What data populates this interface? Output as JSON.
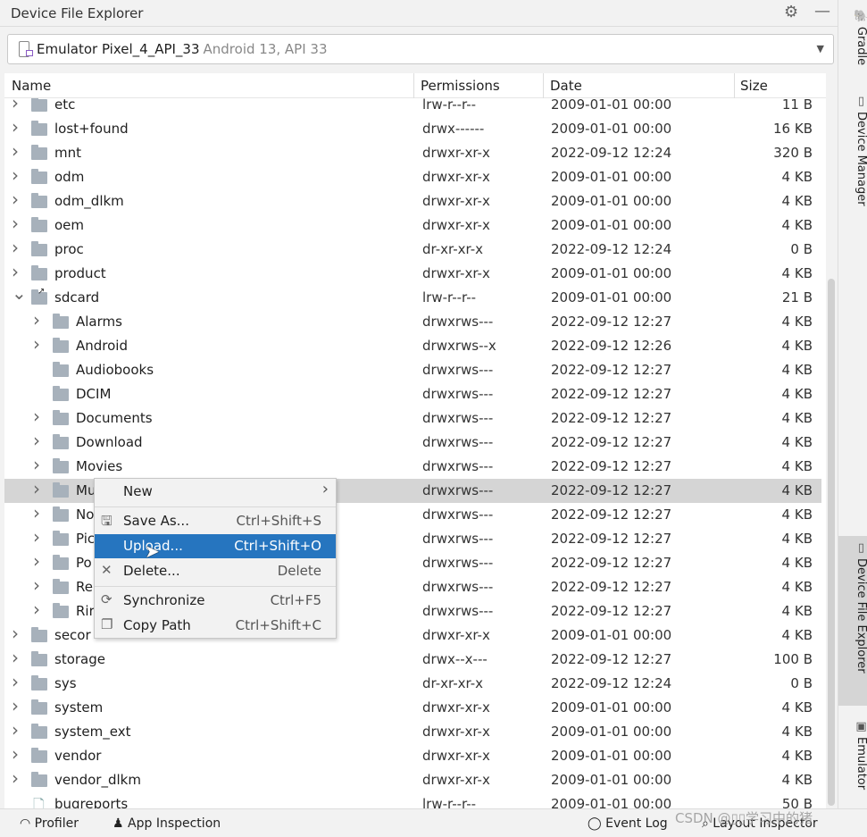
{
  "panel": {
    "title": "Device File Explorer",
    "settings_icon": "gear-icon",
    "minimize_icon": "minimize-icon"
  },
  "device": {
    "name": "Emulator Pixel_4_API_33",
    "subtitle": "Android 13, API 33"
  },
  "columns": {
    "name": "Name",
    "permissions": "Permissions",
    "date": "Date",
    "size": "Size"
  },
  "rows": [
    {
      "name": "etc",
      "perm": "lrw-r--r--",
      "date": "2009-01-01 00:00",
      "size": "11 B",
      "level": 0,
      "arrow": "collapsed",
      "icon": "folder",
      "partial": true
    },
    {
      "name": "lost+found",
      "perm": "drwx------",
      "date": "2009-01-01 00:00",
      "size": "16 KB",
      "level": 0,
      "arrow": "collapsed",
      "icon": "folder"
    },
    {
      "name": "mnt",
      "perm": "drwxr-xr-x",
      "date": "2022-09-12 12:24",
      "size": "320 B",
      "level": 0,
      "arrow": "collapsed",
      "icon": "folder"
    },
    {
      "name": "odm",
      "perm": "drwxr-xr-x",
      "date": "2009-01-01 00:00",
      "size": "4 KB",
      "level": 0,
      "arrow": "collapsed",
      "icon": "folder"
    },
    {
      "name": "odm_dlkm",
      "perm": "drwxr-xr-x",
      "date": "2009-01-01 00:00",
      "size": "4 KB",
      "level": 0,
      "arrow": "collapsed",
      "icon": "folder"
    },
    {
      "name": "oem",
      "perm": "drwxr-xr-x",
      "date": "2009-01-01 00:00",
      "size": "4 KB",
      "level": 0,
      "arrow": "collapsed",
      "icon": "folder"
    },
    {
      "name": "proc",
      "perm": "dr-xr-xr-x",
      "date": "2022-09-12 12:24",
      "size": "0 B",
      "level": 0,
      "arrow": "collapsed",
      "icon": "folder"
    },
    {
      "name": "product",
      "perm": "drwxr-xr-x",
      "date": "2009-01-01 00:00",
      "size": "4 KB",
      "level": 0,
      "arrow": "collapsed",
      "icon": "folder"
    },
    {
      "name": "sdcard",
      "perm": "lrw-r--r--",
      "date": "2009-01-01 00:00",
      "size": "21 B",
      "level": 0,
      "arrow": "expanded",
      "icon": "folder-link"
    },
    {
      "name": "Alarms",
      "perm": "drwxrws---",
      "date": "2022-09-12 12:27",
      "size": "4 KB",
      "level": 1,
      "arrow": "collapsed",
      "icon": "folder"
    },
    {
      "name": "Android",
      "perm": "drwxrws--x",
      "date": "2022-09-12 12:26",
      "size": "4 KB",
      "level": 1,
      "arrow": "collapsed",
      "icon": "folder"
    },
    {
      "name": "Audiobooks",
      "perm": "drwxrws---",
      "date": "2022-09-12 12:27",
      "size": "4 KB",
      "level": 1,
      "arrow": "none",
      "icon": "folder"
    },
    {
      "name": "DCIM",
      "perm": "drwxrws---",
      "date": "2022-09-12 12:27",
      "size": "4 KB",
      "level": 1,
      "arrow": "none",
      "icon": "folder"
    },
    {
      "name": "Documents",
      "perm": "drwxrws---",
      "date": "2022-09-12 12:27",
      "size": "4 KB",
      "level": 1,
      "arrow": "collapsed",
      "icon": "folder"
    },
    {
      "name": "Download",
      "perm": "drwxrws---",
      "date": "2022-09-12 12:27",
      "size": "4 KB",
      "level": 1,
      "arrow": "collapsed",
      "icon": "folder"
    },
    {
      "name": "Movies",
      "perm": "drwxrws---",
      "date": "2022-09-12 12:27",
      "size": "4 KB",
      "level": 1,
      "arrow": "collapsed",
      "icon": "folder"
    },
    {
      "name": "Mu",
      "perm": "drwxrws---",
      "date": "2022-09-12 12:27",
      "size": "4 KB",
      "level": 1,
      "arrow": "collapsed",
      "icon": "folder",
      "selected": true
    },
    {
      "name": "No",
      "perm": "drwxrws---",
      "date": "2022-09-12 12:27",
      "size": "4 KB",
      "level": 1,
      "arrow": "collapsed",
      "icon": "folder"
    },
    {
      "name": "Pic",
      "perm": "drwxrws---",
      "date": "2022-09-12 12:27",
      "size": "4 KB",
      "level": 1,
      "arrow": "collapsed",
      "icon": "folder"
    },
    {
      "name": "Po",
      "perm": "drwxrws---",
      "date": "2022-09-12 12:27",
      "size": "4 KB",
      "level": 1,
      "arrow": "collapsed",
      "icon": "folder"
    },
    {
      "name": "Re",
      "perm": "drwxrws---",
      "date": "2022-09-12 12:27",
      "size": "4 KB",
      "level": 1,
      "arrow": "collapsed",
      "icon": "folder"
    },
    {
      "name": "Rir",
      "perm": "drwxrws---",
      "date": "2022-09-12 12:27",
      "size": "4 KB",
      "level": 1,
      "arrow": "collapsed",
      "icon": "folder"
    },
    {
      "name": "secor",
      "perm": "drwxr-xr-x",
      "date": "2009-01-01 00:00",
      "size": "4 KB",
      "level": 0,
      "arrow": "collapsed",
      "icon": "folder"
    },
    {
      "name": "storage",
      "perm": "drwx--x---",
      "date": "2022-09-12 12:27",
      "size": "100 B",
      "level": 0,
      "arrow": "collapsed",
      "icon": "folder"
    },
    {
      "name": "sys",
      "perm": "dr-xr-xr-x",
      "date": "2022-09-12 12:24",
      "size": "0 B",
      "level": 0,
      "arrow": "collapsed",
      "icon": "folder"
    },
    {
      "name": "system",
      "perm": "drwxr-xr-x",
      "date": "2009-01-01 00:00",
      "size": "4 KB",
      "level": 0,
      "arrow": "collapsed",
      "icon": "folder"
    },
    {
      "name": "system_ext",
      "perm": "drwxr-xr-x",
      "date": "2009-01-01 00:00",
      "size": "4 KB",
      "level": 0,
      "arrow": "collapsed",
      "icon": "folder"
    },
    {
      "name": "vendor",
      "perm": "drwxr-xr-x",
      "date": "2009-01-01 00:00",
      "size": "4 KB",
      "level": 0,
      "arrow": "collapsed",
      "icon": "folder"
    },
    {
      "name": "vendor_dlkm",
      "perm": "drwxr-xr-x",
      "date": "2009-01-01 00:00",
      "size": "4 KB",
      "level": 0,
      "arrow": "collapsed",
      "icon": "folder"
    },
    {
      "name": "bugreports",
      "perm": "lrw-r--r--",
      "date": "2009-01-01 00:00",
      "size": "50 B",
      "level": 0,
      "arrow": "none",
      "icon": "file-link"
    }
  ],
  "context_menu": [
    {
      "label": "New",
      "shortcut": "",
      "icon": "",
      "submenu": true
    },
    {
      "sep": true
    },
    {
      "label": "Save As...",
      "shortcut": "Ctrl+Shift+S",
      "icon": "save-icon"
    },
    {
      "label": "Upload...",
      "shortcut": "Ctrl+Shift+O",
      "icon": "",
      "highlighted": true
    },
    {
      "label": "Delete...",
      "shortcut": "Delete",
      "icon": "delete-icon"
    },
    {
      "sep": true
    },
    {
      "label": "Synchronize",
      "shortcut": "Ctrl+F5",
      "icon": "sync-icon"
    },
    {
      "label": "Copy Path",
      "shortcut": "Ctrl+Shift+C",
      "icon": "copy-icon"
    }
  ],
  "right_tabs": [
    {
      "label": "Gradle",
      "icon": "gradle-icon"
    },
    {
      "label": "Device Manager",
      "icon": "device-icon"
    },
    {
      "label": "Device File Explorer",
      "icon": "device-icon",
      "selected": true
    },
    {
      "label": "Emulator",
      "icon": "emulator-icon"
    }
  ],
  "bottom_tabs": {
    "profiler": "Profiler",
    "app_inspection": "App Inspection",
    "event_log": "Event Log",
    "layout_inspector": "Layout Inspector"
  },
  "watermark": "CSDN @▯▯学习中的猪",
  "colors": {
    "highlight": "#2675bf",
    "selected_row": "#d5d5d5"
  }
}
